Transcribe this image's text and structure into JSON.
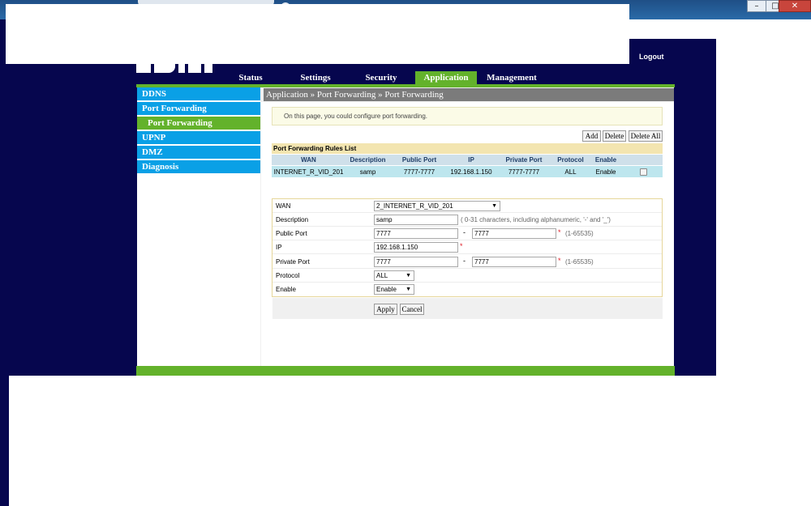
{
  "window": {
    "controls": [
      "–",
      "□",
      "✕"
    ]
  },
  "header": {
    "logout": "Logout"
  },
  "tabs": [
    {
      "label": "Status",
      "active": false
    },
    {
      "label": "Settings",
      "active": false
    },
    {
      "label": "Security",
      "active": false
    },
    {
      "label": "Application",
      "active": true
    },
    {
      "label": "Management",
      "active": false
    }
  ],
  "sidebar": {
    "items": [
      {
        "label": "DDNS"
      },
      {
        "label": "Port Forwarding"
      },
      {
        "label": "Port Forwarding",
        "sub": true
      },
      {
        "label": "UPNP"
      },
      {
        "label": "DMZ"
      },
      {
        "label": "Diagnosis"
      }
    ]
  },
  "breadcrumb": "Application » Port Forwarding » Port Forwarding",
  "note": "On this page, you could configure port forwarding.",
  "list_buttons": {
    "add": "Add",
    "delete": "Delete",
    "delete_all": "Delete All"
  },
  "rules": {
    "title": "Port Forwarding Rules List",
    "columns": [
      "WAN",
      "Description",
      "Public Port",
      "IP",
      "Private Port",
      "Protocol",
      "Enable"
    ],
    "rows": [
      [
        "INTERNET_R_VID_201",
        "samp",
        "7777-7777",
        "192.168.1.150",
        "7777-7777",
        "ALL",
        "Enable"
      ]
    ]
  },
  "form": {
    "wan": {
      "label": "WAN",
      "value": "2_INTERNET_R_VID_201"
    },
    "description": {
      "label": "Description",
      "value": "samp",
      "hint": "( 0-31 characters, including alphanumeric, '-' and '_')"
    },
    "public_port": {
      "label": "Public Port",
      "from": "7777",
      "to": "7777",
      "dash": "-",
      "hint": "(1-65535)"
    },
    "ip": {
      "label": "IP",
      "value": "192.168.1.150"
    },
    "private_port": {
      "label": "Private Port",
      "from": "7777",
      "to": "7777",
      "dash": "-",
      "hint": "(1-65535)"
    },
    "protocol": {
      "label": "Protocol",
      "value": "ALL"
    },
    "enable": {
      "label": "Enable",
      "value": "Enable"
    },
    "required_mark": "*",
    "apply": "Apply",
    "cancel": "Cancel"
  }
}
